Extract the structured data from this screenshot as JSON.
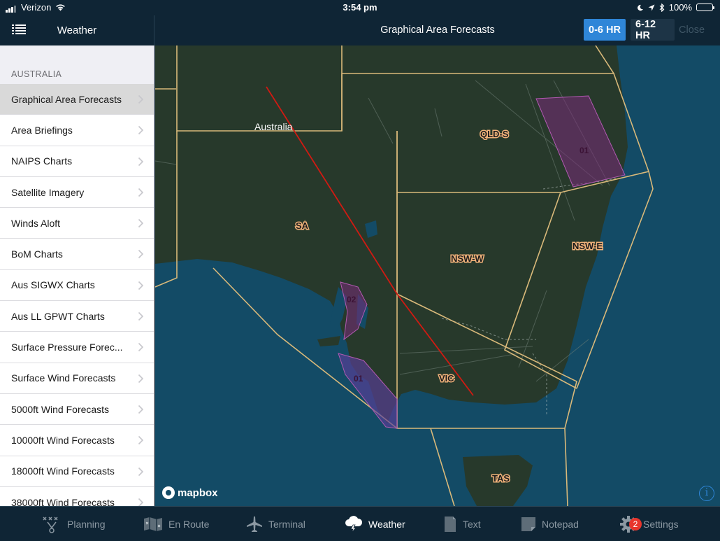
{
  "status_bar": {
    "carrier": "Verizon",
    "time": "3:54 pm",
    "battery": "100%"
  },
  "sidebar": {
    "title": "Weather",
    "section": "AUSTRALIA",
    "items": [
      {
        "label": "Graphical Area Forecasts",
        "selected": true
      },
      {
        "label": "Area Briefings"
      },
      {
        "label": "NAIPS Charts"
      },
      {
        "label": "Satellite Imagery"
      },
      {
        "label": "Winds Aloft"
      },
      {
        "label": "BoM Charts"
      },
      {
        "label": "Aus SIGWX Charts"
      },
      {
        "label": "Aus LL GPWT Charts"
      },
      {
        "label": "Surface Pressure Forec..."
      },
      {
        "label": "Surface Wind Forecasts"
      },
      {
        "label": "5000ft Wind Forecasts"
      },
      {
        "label": "10000ft Wind Forecasts"
      },
      {
        "label": "18000ft Wind Forecasts"
      },
      {
        "label": "38000ft Wind Forecasts"
      }
    ]
  },
  "header": {
    "title": "Graphical Area Forecasts",
    "segments": [
      "0-6 HR",
      "6-12 HR"
    ],
    "active_segment": "0-6 HR",
    "close_label": "Close"
  },
  "map": {
    "place_label": "Australia",
    "regions": [
      "QLD-S",
      "SA",
      "NSW-W",
      "NSW-E",
      "VIC",
      "TAS"
    ],
    "areas": [
      "01",
      "02",
      "01"
    ],
    "attribution": "mapbox",
    "info_glyph": "i",
    "colors": {
      "ocean": "#134b66",
      "land": "#27392b",
      "boundary": "#d9b97a",
      "route": "#d11a12",
      "area_fill": "#7a2c7a"
    }
  },
  "tabbar": {
    "tabs": [
      {
        "label": "Planning",
        "icon": "planning-icon"
      },
      {
        "label": "En Route",
        "icon": "map-icon"
      },
      {
        "label": "Terminal",
        "icon": "airplane-icon"
      },
      {
        "label": "Weather",
        "icon": "cloud-lightning-icon",
        "active": true
      },
      {
        "label": "Text",
        "icon": "document-icon"
      },
      {
        "label": "Notepad",
        "icon": "notepad-icon"
      },
      {
        "label": "Settings",
        "icon": "gear-icon",
        "badge": "2"
      }
    ]
  }
}
